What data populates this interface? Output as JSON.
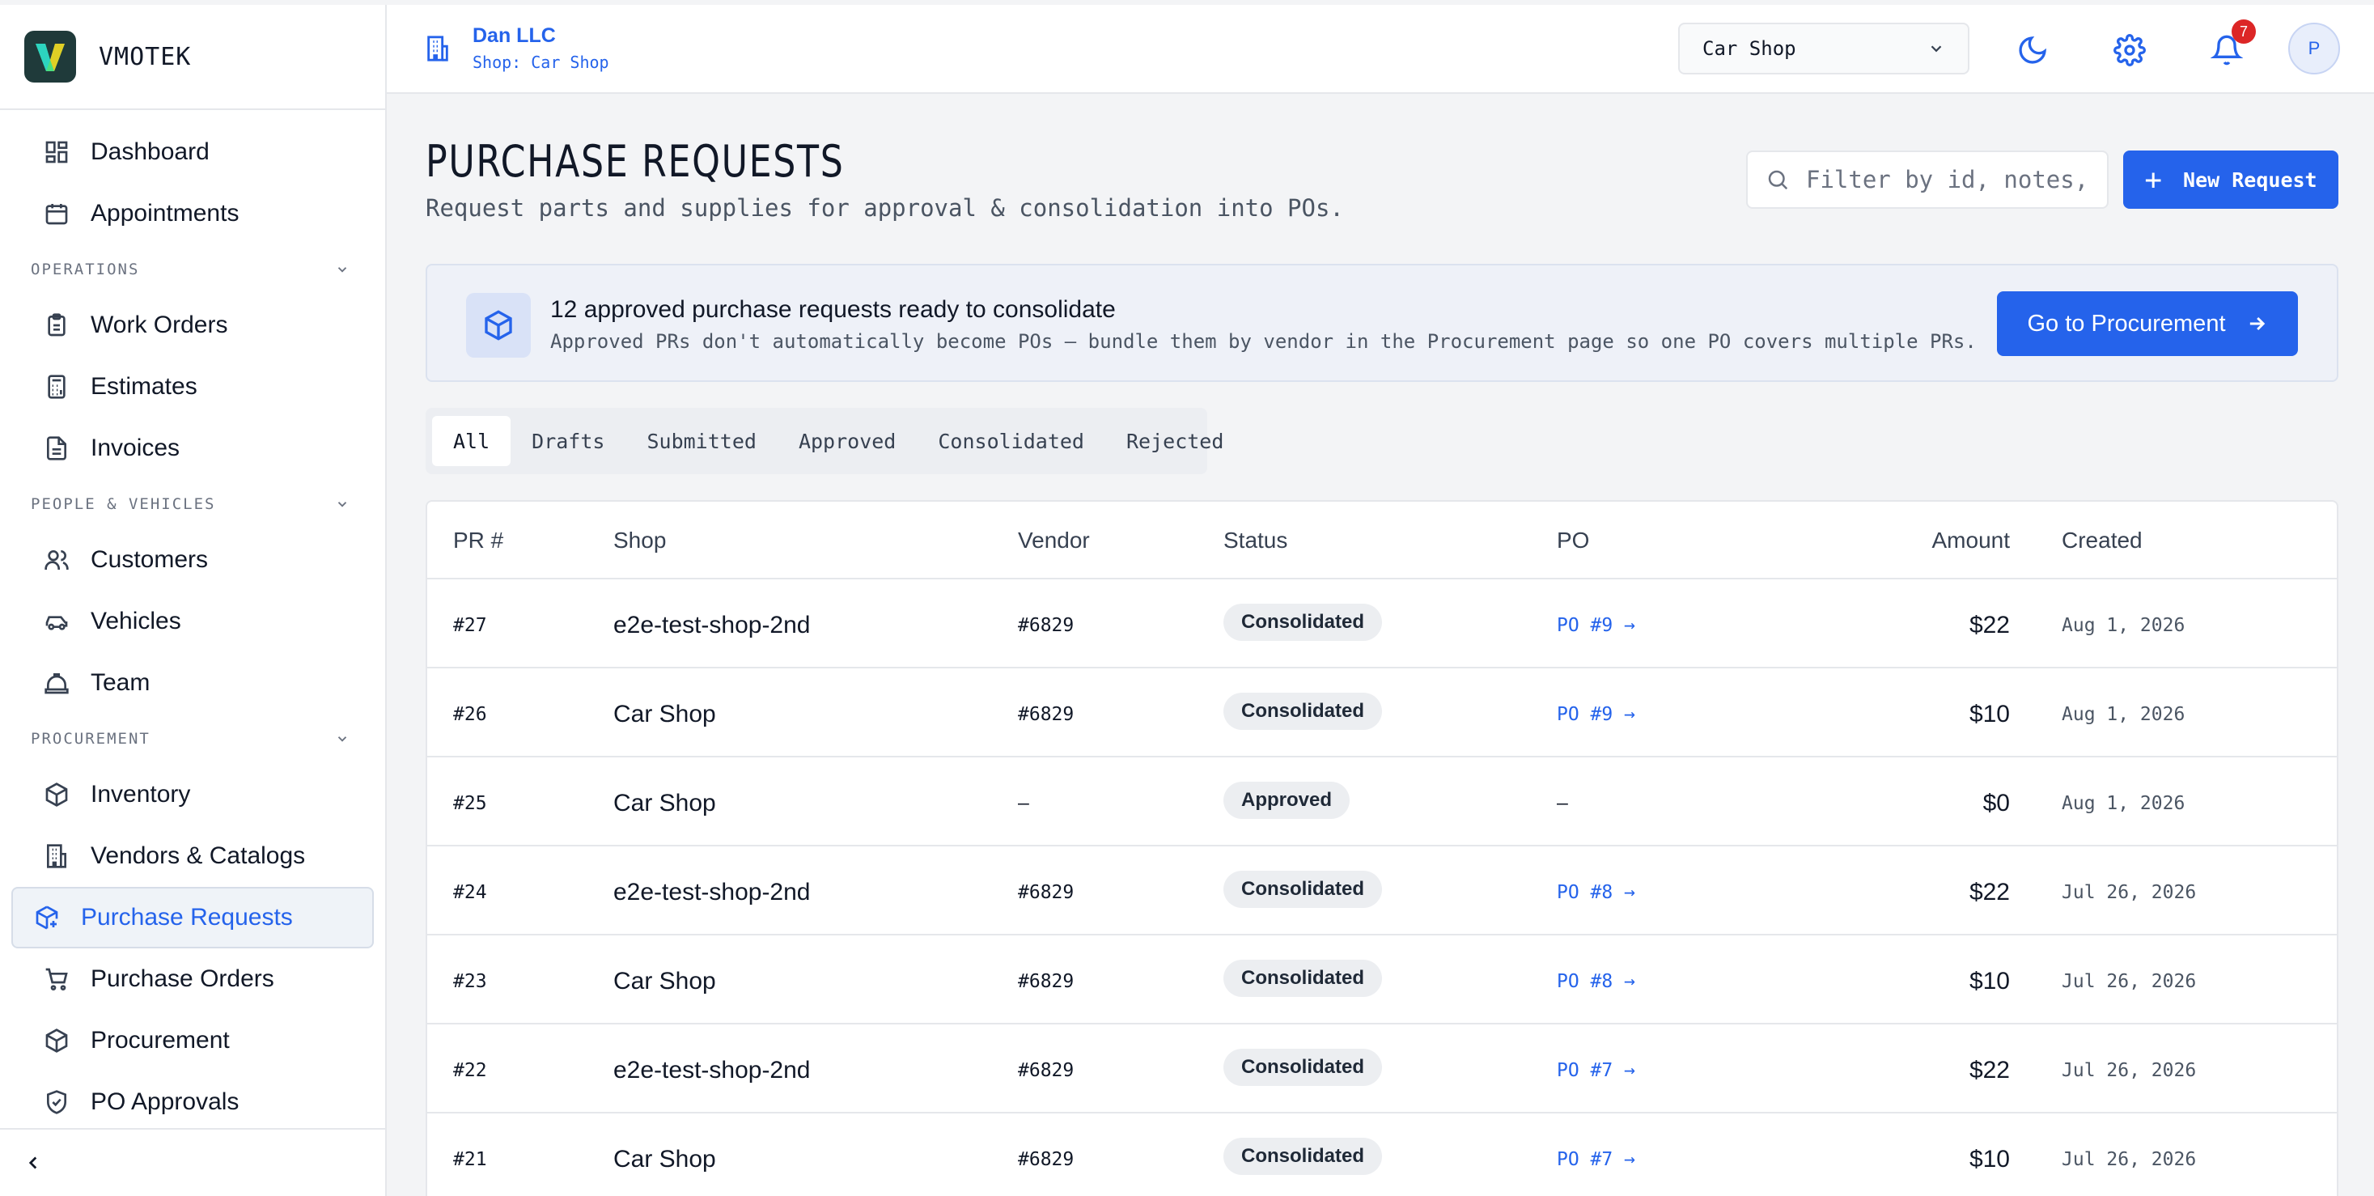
{
  "brand": {
    "name": "VMOTEK",
    "logo_letter": "V"
  },
  "sidebar": {
    "items_top": [
      {
        "label": "Dashboard",
        "icon": "dashboard-icon"
      },
      {
        "label": "Appointments",
        "icon": "calendar-icon"
      }
    ],
    "sections": [
      {
        "title": "OPERATIONS",
        "items": [
          {
            "label": "Work Orders",
            "icon": "clipboard-icon"
          },
          {
            "label": "Estimates",
            "icon": "calculator-icon"
          },
          {
            "label": "Invoices",
            "icon": "file-icon"
          }
        ]
      },
      {
        "title": "PEOPLE & VEHICLES",
        "items": [
          {
            "label": "Customers",
            "icon": "users-icon"
          },
          {
            "label": "Vehicles",
            "icon": "car-icon"
          },
          {
            "label": "Team",
            "icon": "hardhat-icon"
          }
        ]
      },
      {
        "title": "PROCUREMENT",
        "items": [
          {
            "label": "Inventory",
            "icon": "package-icon"
          },
          {
            "label": "Vendors & Catalogs",
            "icon": "building-icon"
          },
          {
            "label": "Purchase Requests",
            "icon": "package-plus-icon",
            "active": true
          },
          {
            "label": "Purchase Orders",
            "icon": "cart-icon"
          },
          {
            "label": "Procurement",
            "icon": "package-icon"
          },
          {
            "label": "PO Approvals",
            "icon": "shield-check-icon"
          }
        ]
      }
    ]
  },
  "topbar": {
    "org_name": "Dan LLC",
    "org_shop": "Shop: Car Shop",
    "shop_select": "Car Shop",
    "notification_count": "7",
    "avatar_initial": "P"
  },
  "page": {
    "title": "PURCHASE REQUESTS",
    "subtitle": "Request parts and supplies for approval & consolidation into POs.",
    "filter_placeholder": "Filter by id, notes, ...",
    "new_request_label": "New Request"
  },
  "banner": {
    "title": "12 approved purchase requests ready to consolidate",
    "text": "Approved PRs don't automatically become POs — bundle them by vendor in the Procurement page so one PO covers multiple PRs.",
    "button_label": "Go to Procurement"
  },
  "tabs": [
    "All",
    "Drafts",
    "Submitted",
    "Approved",
    "Consolidated",
    "Rejected"
  ],
  "table": {
    "headers": {
      "pr": "PR #",
      "shop": "Shop",
      "vendor": "Vendor",
      "status": "Status",
      "po": "PO",
      "amount": "Amount",
      "created": "Created"
    },
    "rows": [
      {
        "pr": "#27",
        "shop": "e2e-test-shop-2nd",
        "vendor": "#6829",
        "status": "Consolidated",
        "po": "PO #9 →",
        "amount": "$22",
        "created": "Aug 1, 2026"
      },
      {
        "pr": "#26",
        "shop": "Car Shop",
        "vendor": "#6829",
        "status": "Consolidated",
        "po": "PO #9 →",
        "amount": "$10",
        "created": "Aug 1, 2026"
      },
      {
        "pr": "#25",
        "shop": "Car Shop",
        "vendor": "–",
        "status": "Approved",
        "po": "—",
        "amount": "$0",
        "created": "Aug 1, 2026"
      },
      {
        "pr": "#24",
        "shop": "e2e-test-shop-2nd",
        "vendor": "#6829",
        "status": "Consolidated",
        "po": "PO #8 →",
        "amount": "$22",
        "created": "Jul 26, 2026"
      },
      {
        "pr": "#23",
        "shop": "Car Shop",
        "vendor": "#6829",
        "status": "Consolidated",
        "po": "PO #8 →",
        "amount": "$10",
        "created": "Jul 26, 2026"
      },
      {
        "pr": "#22",
        "shop": "e2e-test-shop-2nd",
        "vendor": "#6829",
        "status": "Consolidated",
        "po": "PO #7 →",
        "amount": "$22",
        "created": "Jul 26, 2026"
      },
      {
        "pr": "#21",
        "shop": "Car Shop",
        "vendor": "#6829",
        "status": "Consolidated",
        "po": "PO #7 →",
        "amount": "$10",
        "created": "Jul 26, 2026"
      }
    ]
  },
  "colors": {
    "accent": "#2563eb",
    "logo_bg": "#1f3a3a",
    "badge_red": "#dc2626"
  }
}
